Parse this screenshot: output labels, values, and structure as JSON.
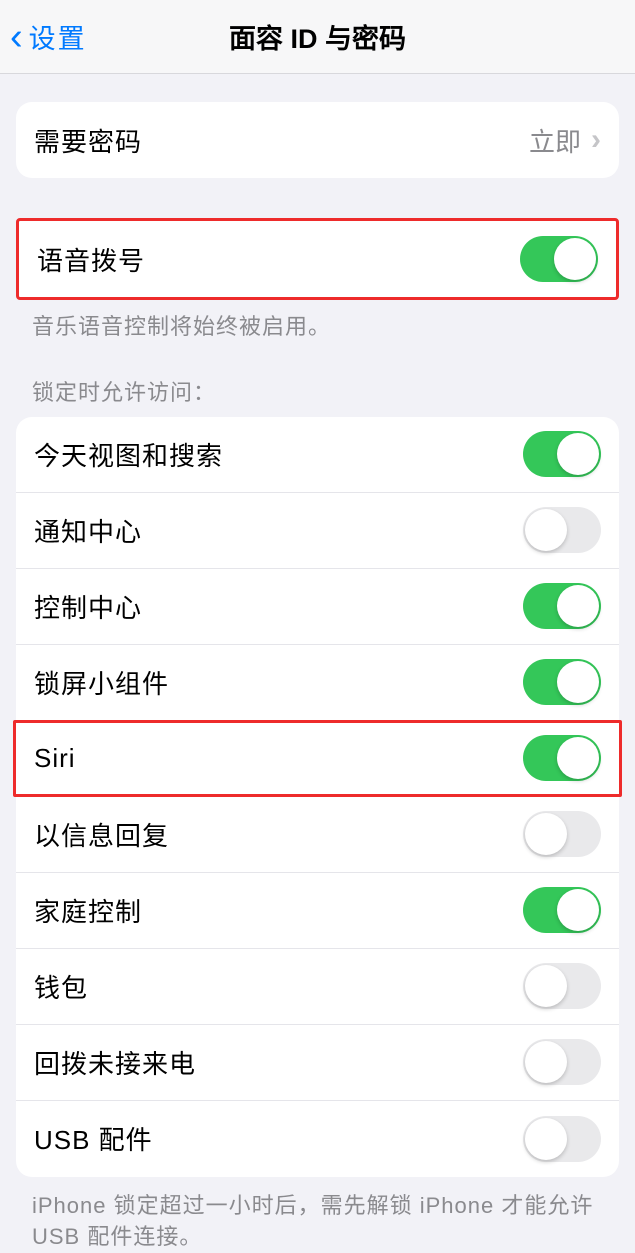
{
  "navbar": {
    "back_label": "设置",
    "title": "面容 ID 与密码"
  },
  "group1": {
    "require_passcode": {
      "label": "需要密码",
      "value": "立即"
    }
  },
  "group2": {
    "voice_dial": {
      "label": "语音拨号",
      "on": true
    },
    "footer": "音乐语音控制将始终被启用。"
  },
  "section_lock": {
    "header": "锁定时允许访问：",
    "items": [
      {
        "label": "今天视图和搜索",
        "on": true
      },
      {
        "label": "通知中心",
        "on": false
      },
      {
        "label": "控制中心",
        "on": true
      },
      {
        "label": "锁屏小组件",
        "on": true
      },
      {
        "label": "Siri",
        "on": true
      },
      {
        "label": "以信息回复",
        "on": false
      },
      {
        "label": "家庭控制",
        "on": true
      },
      {
        "label": "钱包",
        "on": false
      },
      {
        "label": "回拨未接来电",
        "on": false
      },
      {
        "label": "USB 配件",
        "on": false
      }
    ],
    "footer": "iPhone 锁定超过一小时后，需先解锁 iPhone 才能允许USB 配件连接。"
  },
  "highlights": {
    "voice_dial_group": true,
    "siri_row_index": 4
  }
}
